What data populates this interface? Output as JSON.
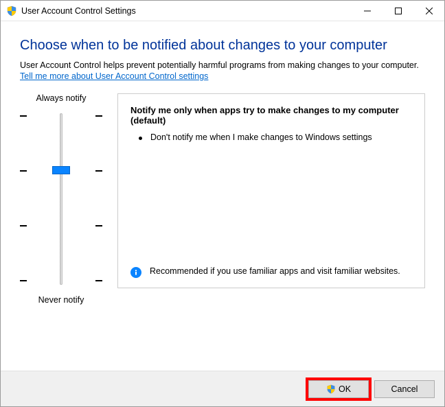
{
  "window": {
    "title": "User Account Control Settings"
  },
  "main": {
    "heading": "Choose when to be notified about changes to your computer",
    "description": "User Account Control helps prevent potentially harmful programs from making changes to your computer.",
    "link": "Tell me more about User Account Control settings"
  },
  "slider": {
    "top_label": "Always notify",
    "bottom_label": "Never notify"
  },
  "info": {
    "title": "Notify me only when apps try to make changes to my computer (default)",
    "bullet": "Don't notify me when I make changes to Windows settings",
    "recommendation": "Recommended if you use familiar apps and visit familiar websites."
  },
  "footer": {
    "ok_label": "OK",
    "cancel_label": "Cancel"
  }
}
